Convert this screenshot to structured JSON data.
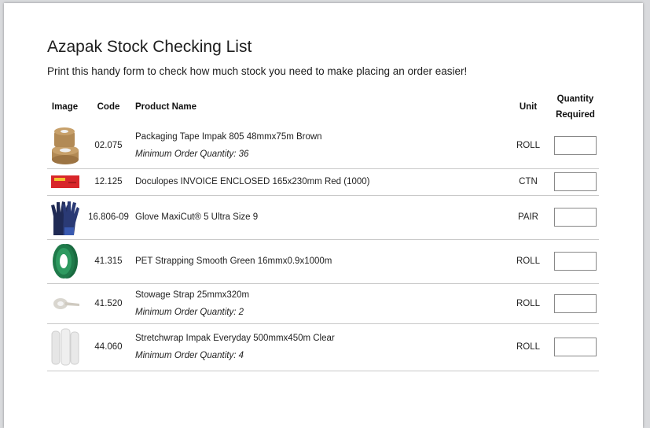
{
  "title": "Azapak Stock Checking List",
  "subtitle": "Print this handy form to check how much stock you need to make placing an order easier!",
  "columns": {
    "image": "Image",
    "code": "Code",
    "name": "Product Name",
    "unit": "Unit",
    "qty_line1": "Quantity",
    "qty_line2": "Required"
  },
  "rows": [
    {
      "image": "tape-rolls-image",
      "code": "02.075",
      "name": "Packaging Tape Impak 805 48mmx75m Brown",
      "moq": "Minimum Order Quantity: 36",
      "unit": "ROLL"
    },
    {
      "image": "red-envelope-image",
      "code": "12.125",
      "name": "Doculopes INVOICE ENCLOSED 165x230mm Red (1000)",
      "moq": "",
      "unit": "CTN"
    },
    {
      "image": "gloves-image",
      "code": "16.806-09",
      "name": "Glove MaxiCut® 5 Ultra Size 9",
      "moq": "",
      "unit": "PAIR"
    },
    {
      "image": "green-strapping-image",
      "code": "41.315",
      "name": "PET Strapping Smooth Green 16mmx0.9x1000m",
      "moq": "",
      "unit": "ROLL"
    },
    {
      "image": "stowage-strap-image",
      "code": "41.520",
      "name": "Stowage Strap 25mmx320m",
      "moq": "Minimum Order Quantity: 2",
      "unit": "ROLL"
    },
    {
      "image": "stretchwrap-image",
      "code": "44.060",
      "name": "Stretchwrap Impak Everyday 500mmx450m Clear",
      "moq": "Minimum Order Quantity: 4",
      "unit": "ROLL"
    }
  ],
  "colors": {
    "tape": "#b28a55",
    "envelope": "#d8262a",
    "glove": "#1f2a55",
    "strapping": "#1f7a4a"
  }
}
